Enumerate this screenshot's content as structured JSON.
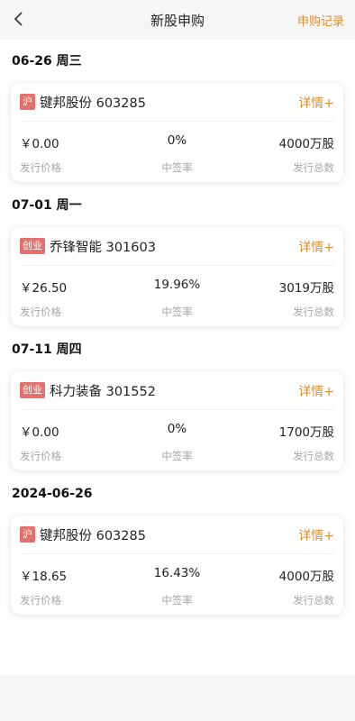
{
  "colors": {
    "accent": "#d98f2f",
    "tag_bg": "#e2716b"
  },
  "header": {
    "back_icon": "chevron-left-icon",
    "title": "新股申购",
    "records_label": "申购记录"
  },
  "groups": [
    {
      "date": "06-26 周三",
      "card": {
        "tag": "沪",
        "name": "键邦股份 603285",
        "detail": "详情+",
        "price": "￥0.00",
        "rate": "0%",
        "total": "4000万股",
        "price_label": "发行价格",
        "rate_label": "中签率",
        "total_label": "发行总数"
      }
    },
    {
      "date": "07-01 周一",
      "card": {
        "tag": "创业",
        "name": "乔锋智能 301603",
        "detail": "详情+",
        "price": "￥26.50",
        "rate": "19.96%",
        "total": "3019万股",
        "price_label": "发行价格",
        "rate_label": "中签率",
        "total_label": "发行总数"
      }
    },
    {
      "date": "07-11 周四",
      "card": {
        "tag": "创业",
        "name": "科力装备 301552",
        "detail": "详情+",
        "price": "￥0.00",
        "rate": "0%",
        "total": "1700万股",
        "price_label": "发行价格",
        "rate_label": "中签率",
        "total_label": "发行总数"
      }
    },
    {
      "date": "2024-06-26",
      "card": {
        "tag": "沪",
        "name": "键邦股份 603285",
        "detail": "详情+",
        "price": "￥18.65",
        "rate": "16.43%",
        "total": "4000万股",
        "price_label": "发行价格",
        "rate_label": "中签率",
        "total_label": "发行总数"
      }
    }
  ]
}
